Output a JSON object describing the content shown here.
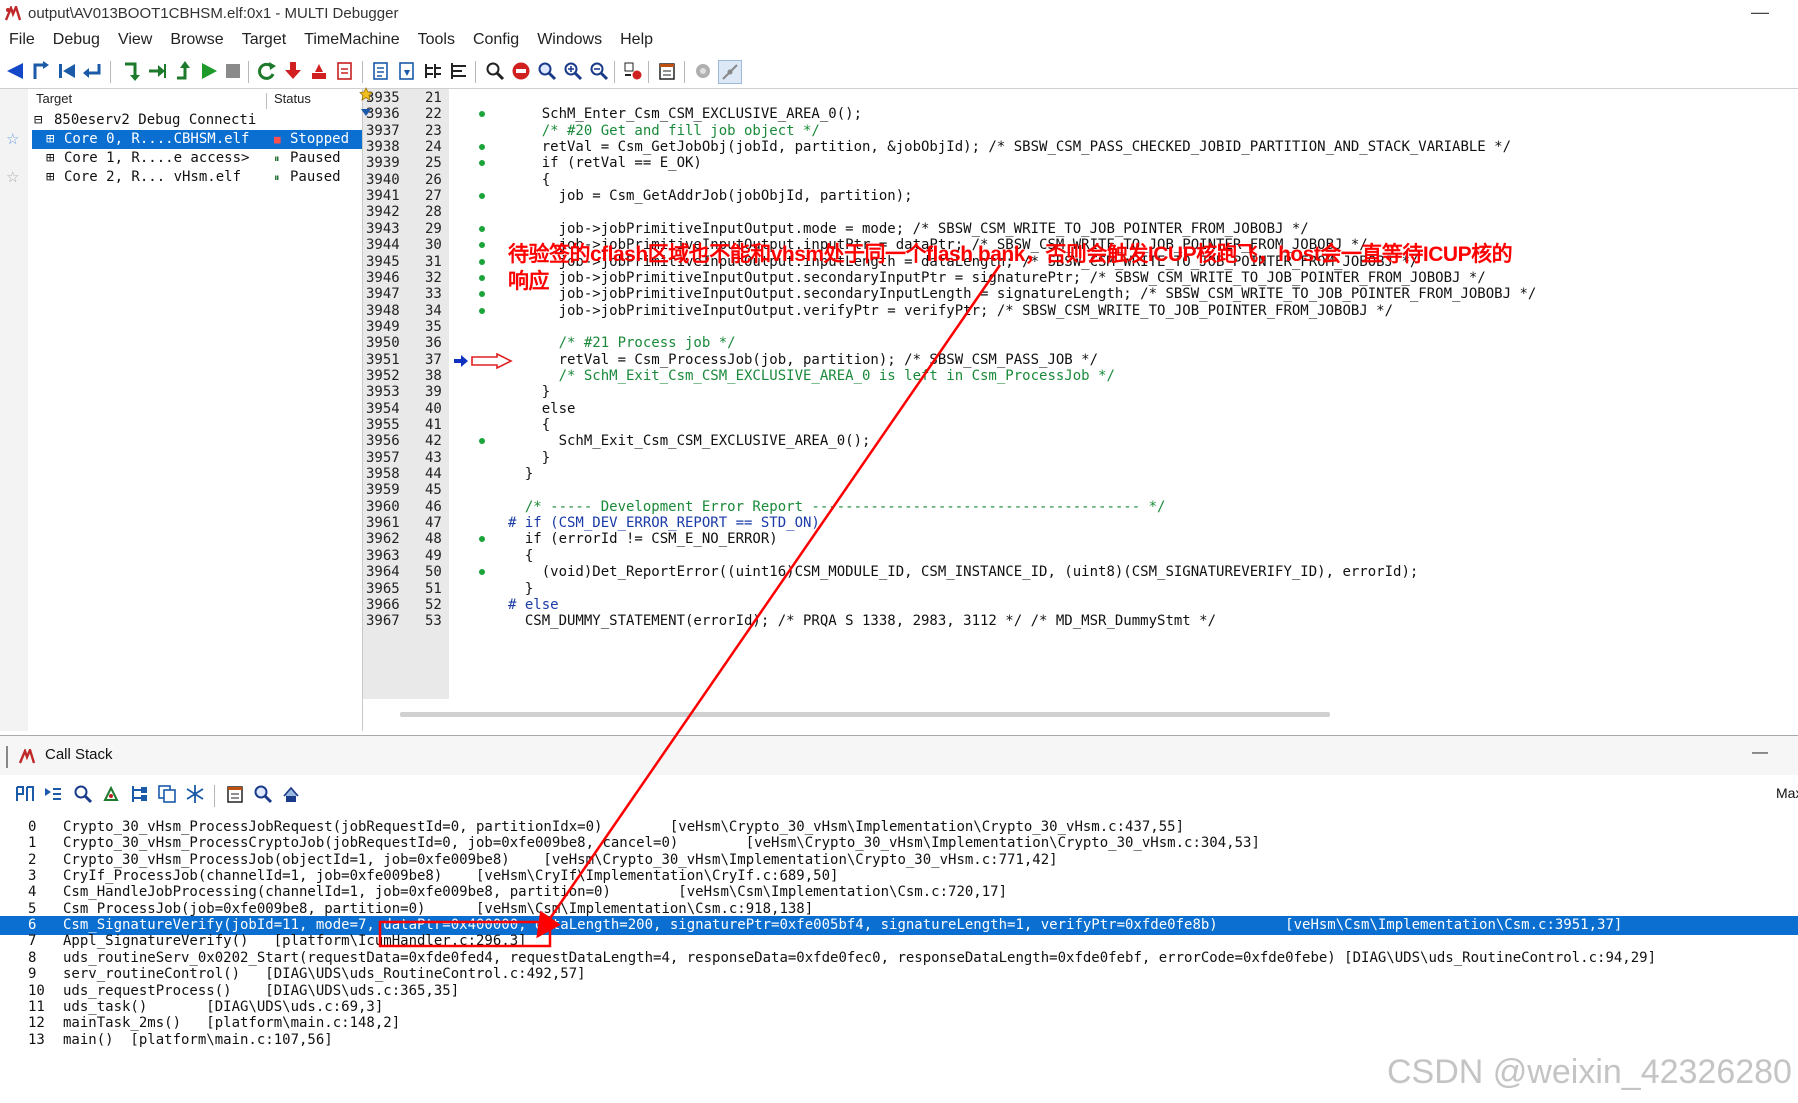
{
  "window": {
    "title": "output\\AV013BOOT1CBHSM.elf:0x1 - MULTI Debugger",
    "minimize_glyph": "—"
  },
  "menu": [
    "File",
    "Debug",
    "View",
    "Browse",
    "Target",
    "TimeMachine",
    "Tools",
    "Config",
    "Windows",
    "Help"
  ],
  "toolbar_icons": [
    "back-arrow-icon",
    "step-up-icon",
    "step-back-icon",
    "step-return-icon",
    "step-into-icon",
    "step-over-icon",
    "step-out-icon",
    "run-icon",
    "halt-icon",
    "restart-icon",
    "download-icon",
    "flash-icon",
    "build-icon",
    "memory-view-icon",
    "register-view-icon",
    "watch-icon",
    "call-stack-icon",
    "find-icon",
    "stop-search-icon",
    "zoom-icon",
    "zoom-in-icon",
    "zoom-out-icon",
    "breakpoints-icon",
    "notepad-icon",
    "trace-icon",
    "connect-icon"
  ],
  "target_list": {
    "headers": {
      "target": "Target",
      "status": "Status"
    },
    "root": "850eserv2 Debug Connecti",
    "rows": [
      {
        "target": "Core 0, R....CBHSM.elf",
        "status": "Stopped",
        "selected": true,
        "status_color": "#e03030"
      },
      {
        "target": "Core 1, R....e access>",
        "status": "Paused",
        "selected": false,
        "status_color": "#222222"
      },
      {
        "target": "Core 2, R... vHsm.elf",
        "status": "Paused",
        "selected": false,
        "status_color": "#222222"
      }
    ]
  },
  "source": {
    "current_line": "3951",
    "lines": [
      {
        "abs": "3935",
        "rel": "21",
        "dot": false,
        "code": ""
      },
      {
        "abs": "3936",
        "rel": "22",
        "dot": true,
        "code": "    SchM_Enter_Csm_CSM_EXCLUSIVE_AREA_0();"
      },
      {
        "abs": "3937",
        "rel": "23",
        "dot": false,
        "code": "    /* #20 Get and fill job object */"
      },
      {
        "abs": "3938",
        "rel": "24",
        "dot": true,
        "code": "    retVal = Csm_GetJobObj(jobId, partition, &jobObjId); /* SBSW_CSM_PASS_CHECKED_JOBID_PARTITION_AND_STACK_VARIABLE */"
      },
      {
        "abs": "3939",
        "rel": "25",
        "dot": true,
        "code": "    if (retVal == E_OK)"
      },
      {
        "abs": "3940",
        "rel": "26",
        "dot": false,
        "code": "    {"
      },
      {
        "abs": "3941",
        "rel": "27",
        "dot": true,
        "code": "      job = Csm_GetAddrJob(jobObjId, partition);"
      },
      {
        "abs": "3942",
        "rel": "28",
        "dot": false,
        "code": ""
      },
      {
        "abs": "3943",
        "rel": "29",
        "dot": true,
        "code": "      job->jobPrimitiveInputOutput.mode = mode; /* SBSW_CSM_WRITE_TO_JOB_POINTER_FROM_JOBOBJ */"
      },
      {
        "abs": "3944",
        "rel": "30",
        "dot": true,
        "code": "      job->jobPrimitiveInputOutput.inputPtr = dataPtr; /* SBSW_CSM_WRITE_TO_JOB_POINTER_FROM_JOBOBJ */"
      },
      {
        "abs": "3945",
        "rel": "31",
        "dot": true,
        "code": "      job->jobPrimitiveInputOutput.inputLength = dataLength; /* SBSW_CSM_WRITE_TO_JOB_POINTER_FROM_JOBOBJ */"
      },
      {
        "abs": "3946",
        "rel": "32",
        "dot": true,
        "code": "      job->jobPrimitiveInputOutput.secondaryInputPtr = signaturePtr; /* SBSW_CSM_WRITE_TO_JOB_POINTER_FROM_JOBOBJ */"
      },
      {
        "abs": "3947",
        "rel": "33",
        "dot": true,
        "code": "      job->jobPrimitiveInputOutput.secondaryInputLength = signatureLength; /* SBSW_CSM_WRITE_TO_JOB_POINTER_FROM_JOBOBJ */"
      },
      {
        "abs": "3948",
        "rel": "34",
        "dot": true,
        "code": "      job->jobPrimitiveInputOutput.verifyPtr = verifyPtr; /* SBSW_CSM_WRITE_TO_JOB_POINTER_FROM_JOBOBJ */"
      },
      {
        "abs": "3949",
        "rel": "35",
        "dot": false,
        "code": ""
      },
      {
        "abs": "3950",
        "rel": "36",
        "dot": false,
        "code": "      /* #21 Process job */"
      },
      {
        "abs": "3951",
        "rel": "37",
        "dot": false,
        "code": "      retVal = Csm_ProcessJob(job, partition); /* SBSW_CSM_PASS_JOB */"
      },
      {
        "abs": "3952",
        "rel": "38",
        "dot": false,
        "code": "      /* SchM_Exit_Csm_CSM_EXCLUSIVE_AREA_0 is left in Csm_ProcessJob */"
      },
      {
        "abs": "3953",
        "rel": "39",
        "dot": false,
        "code": "    }"
      },
      {
        "abs": "3954",
        "rel": "40",
        "dot": false,
        "code": "    else"
      },
      {
        "abs": "3955",
        "rel": "41",
        "dot": false,
        "code": "    {"
      },
      {
        "abs": "3956",
        "rel": "42",
        "dot": true,
        "code": "      SchM_Exit_Csm_CSM_EXCLUSIVE_AREA_0();"
      },
      {
        "abs": "3957",
        "rel": "43",
        "dot": false,
        "code": "    }"
      },
      {
        "abs": "3958",
        "rel": "44",
        "dot": false,
        "code": "  }"
      },
      {
        "abs": "3959",
        "rel": "45",
        "dot": false,
        "code": ""
      },
      {
        "abs": "3960",
        "rel": "46",
        "dot": false,
        "code": "  /* ----- Development Error Report --------------------------------------- */"
      },
      {
        "abs": "3961",
        "rel": "47",
        "dot": false,
        "code": "# if (CSM_DEV_ERROR_REPORT == STD_ON)"
      },
      {
        "abs": "3962",
        "rel": "48",
        "dot": true,
        "code": "  if (errorId != CSM_E_NO_ERROR)"
      },
      {
        "abs": "3963",
        "rel": "49",
        "dot": false,
        "code": "  {"
      },
      {
        "abs": "3964",
        "rel": "50",
        "dot": true,
        "code": "    (void)Det_ReportError((uint16)CSM_MODULE_ID, CSM_INSTANCE_ID, (uint8)(CSM_SIGNATUREVERIFY_ID), errorId);"
      },
      {
        "abs": "3965",
        "rel": "51",
        "dot": false,
        "code": "  }"
      },
      {
        "abs": "3966",
        "rel": "52",
        "dot": false,
        "code": "# else"
      },
      {
        "abs": "3967",
        "rel": "53",
        "dot": false,
        "code": "  CSM_DUMMY_STATEMENT(errorId); /* PRQA S 1338, 2983, 3112 */ /* MD_MSR_DummyStmt */"
      }
    ]
  },
  "callstack": {
    "title": "Call Stack",
    "collapse_glyph": "—",
    "max_label": "Max",
    "toolbar_icons": [
      "frame-icon",
      "list-icon",
      "zoom-icon",
      "settings-icon",
      "tree-icon",
      "copy-icon",
      "snowflake-icon",
      "notepad-icon",
      "find-icon",
      "export-icon"
    ],
    "frames": [
      {
        "idx": "0",
        "text": "Crypto_30_vHsm_ProcessJobRequest(jobRequestId=0, partitionIdx=0)        [veHsm\\Crypto_30_vHsm\\Implementation\\Crypto_30_vHsm.c:437,55]",
        "selected": false
      },
      {
        "idx": "1",
        "text": "Crypto_30_vHsm_ProcessCryptoJob(jobRequestId=0, job=0xfe009be8, cancel=0)        [veHsm\\Crypto_30_vHsm\\Implementation\\Crypto_30_vHsm.c:304,53]",
        "selected": false
      },
      {
        "idx": "2",
        "text": "Crypto_30_vHsm_ProcessJob(objectId=1, job=0xfe009be8)    [veHsm\\Crypto_30_vHsm\\Implementation\\Crypto_30_vHsm.c:771,42]",
        "selected": false
      },
      {
        "idx": "3",
        "text": "CryIf_ProcessJob(channelId=1, job=0xfe009be8)    [veHsm\\CryIf\\Implementation\\CryIf.c:689,50]",
        "selected": false
      },
      {
        "idx": "4",
        "text": "Csm_HandleJobProcessing(channelId=1, job=0xfe009be8, partition=0)        [veHsm\\Csm\\Implementation\\Csm.c:720,17]",
        "selected": false
      },
      {
        "idx": "5",
        "text": "Csm_ProcessJob(job=0xfe009be8, partition=0)      [veHsm\\Csm\\Implementation\\Csm.c:918,138]",
        "selected": false
      },
      {
        "idx": "6",
        "text": "Csm_SignatureVerify(jobId=11, mode=7, dataPtr=0x400000, dataLength=200, signaturePtr=0xfe005bf4, signatureLength=1, verifyPtr=0xfde0fe8b)        [veHsm\\Csm\\Implementation\\Csm.c:3951,37]",
        "selected": true
      },
      {
        "idx": "7",
        "text": "Appl_SignatureVerify()   [platform\\IcumHandler.c:296,3]",
        "selected": false
      },
      {
        "idx": "8",
        "text": "uds_routineServ_0x0202_Start(requestData=0xfde0fed4, requestDataLength=4, responseData=0xfde0fec0, responseDataLength=0xfde0febf, errorCode=0xfde0febe) [DIAG\\UDS\\uds_RoutineControl.c:94,29]",
        "selected": false
      },
      {
        "idx": "9",
        "text": "serv_routineControl()   [DIAG\\UDS\\uds_RoutineControl.c:492,57]",
        "selected": false
      },
      {
        "idx": "10",
        "text": "uds_requestProcess()    [DIAG\\UDS\\uds.c:365,35]",
        "selected": false
      },
      {
        "idx": "11",
        "text": "uds_task()       [DIAG\\UDS\\uds.c:69,3]",
        "selected": false
      },
      {
        "idx": "12",
        "text": "mainTask_2ms()   [platform\\main.c:148,2]",
        "selected": false
      },
      {
        "idx": "13",
        "text": "main()  [platform\\main.c:107,56]",
        "selected": false
      }
    ]
  },
  "annotation": {
    "line1": "待验签的cflash区域也不能和vhsm处于同一个flash bank，否则会触发ICUP核跑飞，host会一直等待ICUP核的",
    "line2": "响应",
    "color": "#ff0000"
  },
  "watermark": "CSDN @weixin_42326280",
  "colors": {
    "selection": "#0a6fd0",
    "coverage_dot": "#1aa43a",
    "annotation": "#ff0000",
    "pc_arrow": "#1030c0"
  }
}
